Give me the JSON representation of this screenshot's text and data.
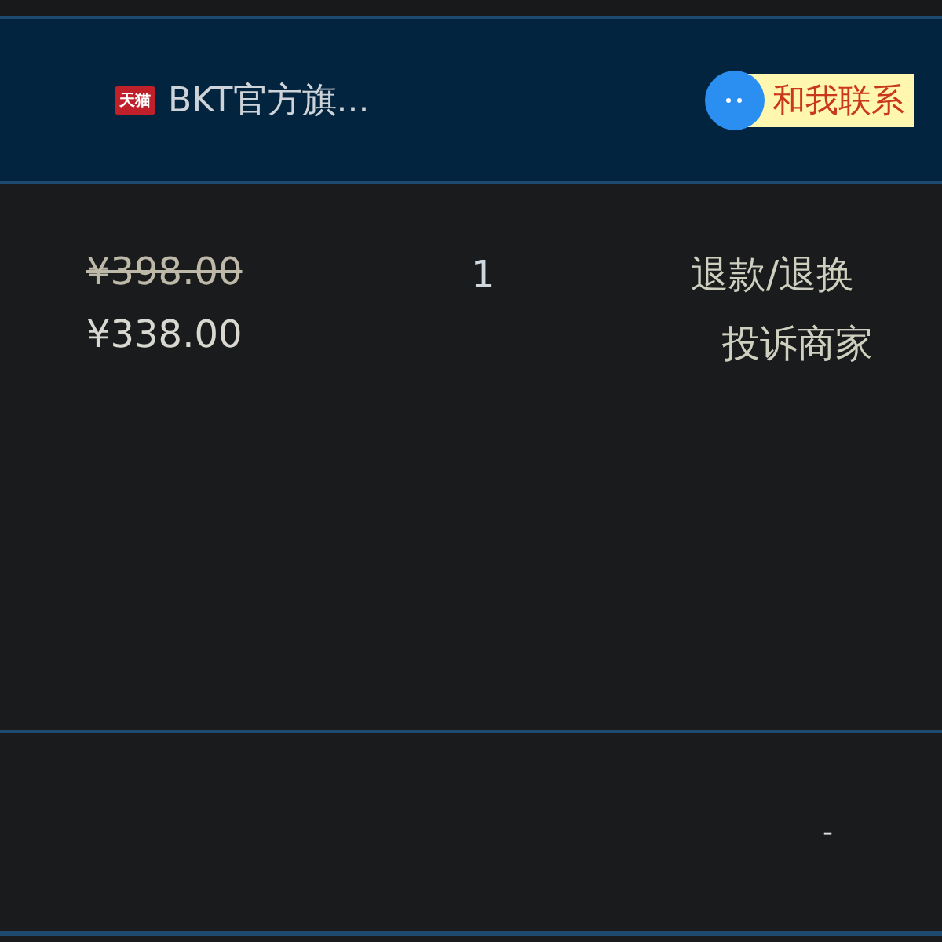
{
  "shop": {
    "badge": "天猫",
    "name": "BKT官方旗...",
    "contact": "和我联系"
  },
  "item": {
    "original_price": "¥398.00",
    "price": "¥338.00",
    "quantity": "1",
    "actions": [
      "退款/退换",
      "投诉商家"
    ]
  },
  "footer": {
    "value": "-"
  }
}
